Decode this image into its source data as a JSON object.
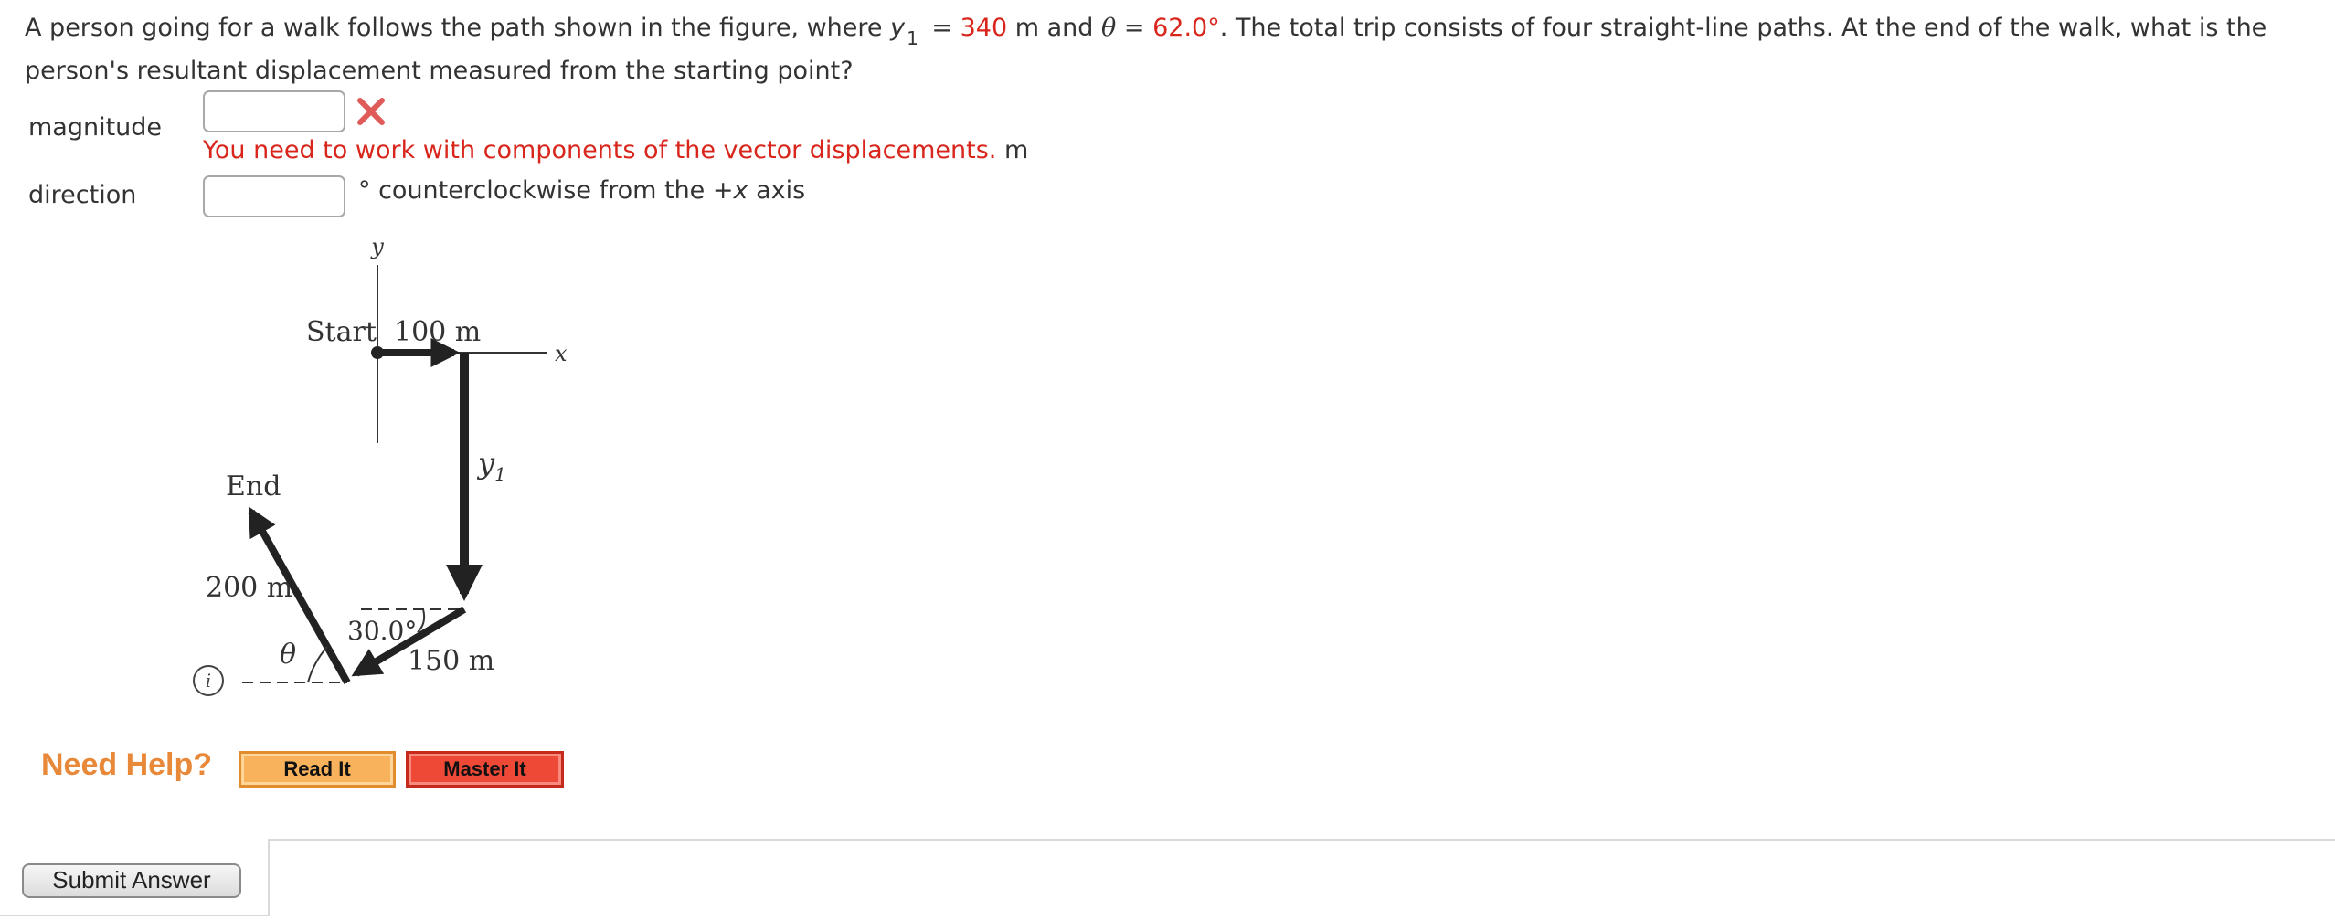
{
  "question": {
    "part1": "A person going for a walk follows the path shown in the figure, where ",
    "y_var": "y",
    "y_sub": "1",
    "eq1": " = ",
    "y1_value": "340",
    "part2": " m and ",
    "theta_var": "θ",
    "eq2": " = ",
    "theta_value": "62.0°",
    "part3": ". The total trip consists of four straight-line paths. At the end of the walk, what is the person's resultant displacement measured from the starting point?"
  },
  "magnitude": {
    "label": "magnitude",
    "value": "",
    "feedback": "You need to work with components of the vector displacements.",
    "unit": "m",
    "status_icon": "x-mark-icon",
    "status_color": "#e05a5a"
  },
  "direction": {
    "label": "direction",
    "value": "",
    "suffix_pre": "° counterclockwise from the +",
    "suffix_var": "x",
    "suffix_post": " axis"
  },
  "figure": {
    "axis_y_label": "y",
    "axis_x_label": "x",
    "start_label": "Start",
    "seg1_label": "100 m",
    "seg2_label_var": "y",
    "seg2_label_sub": "1",
    "seg3_label": "150 m",
    "seg3_angle_label": "30.0°",
    "seg4_label": "200 m",
    "seg4_angle_label": "θ",
    "end_label": "End"
  },
  "info_icon": {
    "glyph": "i",
    "name": "info-icon"
  },
  "help": {
    "label": "Need Help?",
    "read_it": "Read It",
    "master_it": "Master It",
    "colors": {
      "need_help": "#e8893a",
      "read_it": "#f7b25b",
      "master_it": "#ee4836"
    }
  },
  "submit": {
    "label": "Submit Answer"
  },
  "colors": {
    "given_value": "#d9261c",
    "feedback": "#d9261c",
    "text": "#333333"
  }
}
